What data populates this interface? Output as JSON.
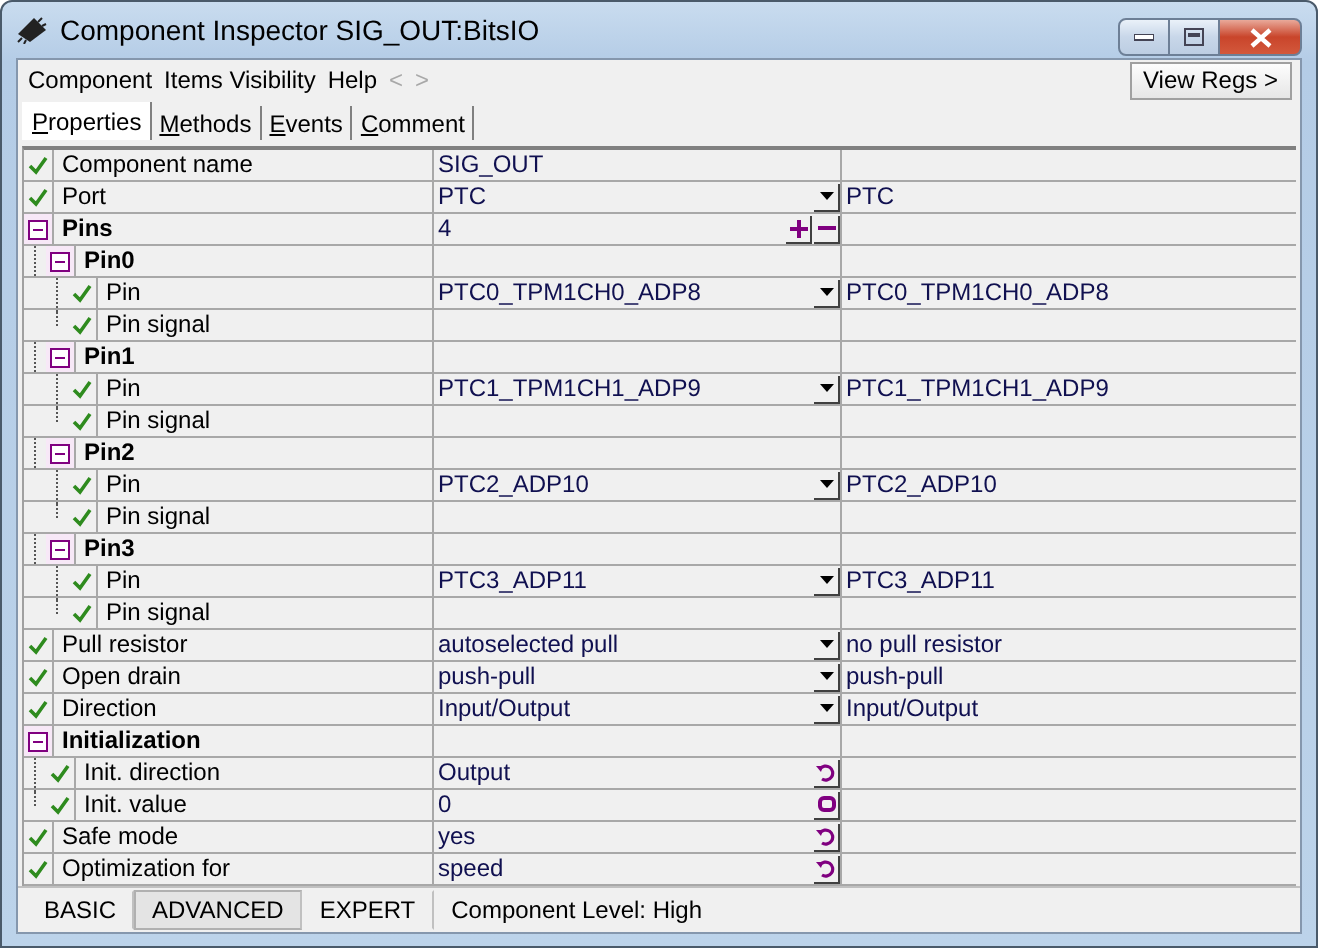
{
  "window": {
    "title": "Component Inspector SIG_OUT:BitsIO"
  },
  "menu": [
    {
      "label": "Component",
      "disabled": false
    },
    {
      "label": "Items Visibility",
      "disabled": false
    },
    {
      "label": "Help",
      "disabled": false
    },
    {
      "label": "<",
      "disabled": true
    },
    {
      "label": ">",
      "disabled": true
    }
  ],
  "view_regs_button": "View Regs >",
  "tabs": [
    {
      "label": "Properties",
      "selected": true
    },
    {
      "label": "Methods",
      "selected": false
    },
    {
      "label": "Events",
      "selected": false
    },
    {
      "label": "Comment",
      "selected": false
    }
  ],
  "properties": [
    {
      "kind": "property",
      "checked": true,
      "name": "Component name",
      "value": "SIG_OUT"
    },
    {
      "kind": "property",
      "checked": true,
      "name": "Port",
      "value": "PTC",
      "editor": {
        "kind": "dropdown"
      },
      "detail": "PTC"
    },
    {
      "kind": "group",
      "expanded": true,
      "name": "Pins",
      "value": "4",
      "editor": {
        "kind": "spin"
      },
      "children": [
        {
          "kind": "group",
          "expanded": true,
          "name": "Pin0",
          "children": [
            {
              "kind": "property",
              "checked": true,
              "name": "Pin",
              "value": "PTC0_TPM1CH0_ADP8",
              "editor": {
                "kind": "dropdown"
              },
              "detail": "PTC0_TPM1CH0_ADP8"
            },
            {
              "kind": "property",
              "checked": true,
              "name": "Pin signal"
            }
          ]
        },
        {
          "kind": "group",
          "expanded": true,
          "name": "Pin1",
          "children": [
            {
              "kind": "property",
              "checked": true,
              "name": "Pin",
              "value": "PTC1_TPM1CH1_ADP9",
              "editor": {
                "kind": "dropdown"
              },
              "detail": "PTC1_TPM1CH1_ADP9"
            },
            {
              "kind": "property",
              "checked": true,
              "name": "Pin signal"
            }
          ]
        },
        {
          "kind": "group",
          "expanded": true,
          "name": "Pin2",
          "children": [
            {
              "kind": "property",
              "checked": true,
              "name": "Pin",
              "value": "PTC2_ADP10",
              "editor": {
                "kind": "dropdown"
              },
              "detail": "PTC2_ADP10"
            },
            {
              "kind": "property",
              "checked": true,
              "name": "Pin signal"
            }
          ]
        },
        {
          "kind": "group",
          "expanded": true,
          "name": "Pin3",
          "children": [
            {
              "kind": "property",
              "checked": true,
              "name": "Pin",
              "value": "PTC3_ADP11",
              "editor": {
                "kind": "dropdown"
              },
              "detail": "PTC3_ADP11"
            },
            {
              "kind": "property",
              "checked": true,
              "name": "Pin signal"
            }
          ]
        }
      ]
    },
    {
      "kind": "property",
      "checked": true,
      "name": "Pull resistor",
      "value": "autoselected pull",
      "editor": {
        "kind": "dropdown"
      },
      "detail": "no pull resistor"
    },
    {
      "kind": "property",
      "checked": true,
      "name": "Open drain",
      "value": "push-pull",
      "editor": {
        "kind": "dropdown"
      },
      "detail": "push-pull"
    },
    {
      "kind": "property",
      "checked": true,
      "name": "Direction",
      "value": "Input/Output",
      "editor": {
        "kind": "dropdown"
      },
      "detail": "Input/Output"
    },
    {
      "kind": "group",
      "expanded": true,
      "name": "Initialization",
      "children": [
        {
          "kind": "property",
          "checked": true,
          "name": "Init. direction",
          "value": "Output",
          "editor": {
            "kind": "toggle"
          }
        },
        {
          "kind": "property",
          "checked": true,
          "name": "Init. value",
          "value": "0",
          "editor": {
            "kind": "binary"
          }
        }
      ]
    },
    {
      "kind": "property",
      "checked": true,
      "name": "Safe mode",
      "value": "yes",
      "editor": {
        "kind": "toggle"
      }
    },
    {
      "kind": "property",
      "checked": true,
      "name": "Optimization for",
      "value": "speed",
      "editor": {
        "kind": "toggle"
      }
    }
  ],
  "levels": [
    {
      "label": "BASIC",
      "selected": false
    },
    {
      "label": "ADVANCED",
      "selected": true
    },
    {
      "label": "EXPERT",
      "selected": false
    }
  ],
  "status": "Component Level: High"
}
